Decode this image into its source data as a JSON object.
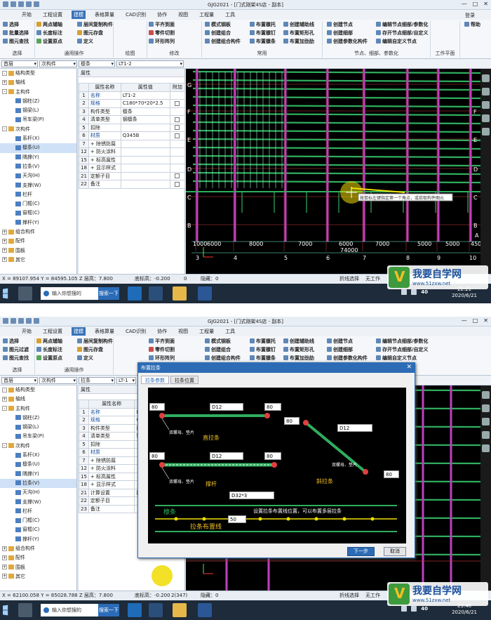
{
  "shot1": {
    "app_title": "GJG2021 - [门式刚架4S店 - 副本]",
    "win_controls": [
      "—",
      "□",
      "✕"
    ],
    "menu": [
      "开始",
      "工程设置",
      "建模",
      "表格算量",
      "CAD识别",
      "协作",
      "视图",
      "工程量",
      "工具"
    ],
    "menu_active": "建模",
    "login": "登录",
    "ribbon": {
      "col1": [
        "选择",
        "批量选择",
        "图元查找"
      ],
      "col2": [
        "两点辅轴",
        "长度标注",
        "设置原点"
      ],
      "col3": [
        "层间复制构件",
        "图元存盘",
        "定义"
      ],
      "col4": [
        "平齐到面",
        "零件切割",
        "环形阵列"
      ],
      "col5": [
        "模式钢板",
        "创建组合",
        "创建组合构件"
      ],
      "col6": [
        "布置檩托",
        "布置檩钉",
        "布置檩条"
      ],
      "col7": [
        "创建辅助线",
        "布置矩形孔",
        "布置加劲肋"
      ],
      "col8": [
        "创建节点",
        "创建细部",
        "创建参数化构件"
      ],
      "col9": [
        "编辑节点细部/参数化",
        "存开节点细部/自定义",
        "编辑自定义节点"
      ],
      "col10": [
        "帮助"
      ],
      "groups": [
        "选择",
        "通用操作",
        "绘图",
        "修改",
        "常用",
        "节点、细部、参数化",
        "工作平面"
      ]
    },
    "prop_combos": [
      "首层",
      "次构件",
      "檩条",
      "LT1-2"
    ],
    "tree": [
      {
        "label": "结构类型",
        "level": 0,
        "expand": "-"
      },
      {
        "label": "轴线",
        "level": 0,
        "expand": "+"
      },
      {
        "label": "主构件",
        "level": 0,
        "expand": "-"
      },
      {
        "label": "钢柱(Z)",
        "level": 1
      },
      {
        "label": "钢梁(L)",
        "level": 1
      },
      {
        "label": "吊车梁(P)",
        "level": 1
      },
      {
        "label": "次构件",
        "level": 0,
        "expand": "-"
      },
      {
        "label": "系杆(X)",
        "level": 1
      },
      {
        "label": "檩条(U)",
        "level": 1,
        "selected": true
      },
      {
        "label": "隅撑(Y)",
        "level": 1
      },
      {
        "label": "拉条(V)",
        "level": 1
      },
      {
        "label": "天沟(H)",
        "level": 1
      },
      {
        "label": "支撑(W)",
        "level": 1
      },
      {
        "label": "栏杆",
        "level": 1
      },
      {
        "label": "门框(C)",
        "level": 1
      },
      {
        "label": "窗框(C)",
        "level": 1
      },
      {
        "label": "撑杆(Y)",
        "level": 1
      },
      {
        "label": "组合构件",
        "level": 0,
        "expand": "+"
      },
      {
        "label": "配件",
        "level": 0,
        "expand": "+"
      },
      {
        "label": "围板",
        "level": 0,
        "expand": "+"
      },
      {
        "label": "其它",
        "level": 0,
        "expand": "+"
      }
    ],
    "props_title": "属性",
    "props_header": [
      "",
      "属性名称",
      "属性值",
      "附加"
    ],
    "props_rows": [
      {
        "n": "1",
        "name": "名称",
        "value": "LT1-2",
        "cb": false
      },
      {
        "n": "2",
        "name": "规格",
        "value": "C180*70*20*2.5",
        "cb": true
      },
      {
        "n": "3",
        "name": "构件类型",
        "value": "檩条",
        "cb": false
      },
      {
        "n": "4",
        "name": "清单类型",
        "value": "钢檩条",
        "cb": true
      },
      {
        "n": "5",
        "name": "扣除",
        "value": "",
        "cb": true
      },
      {
        "n": "6",
        "name": "材质",
        "value": "Q345B",
        "cb": true
      },
      {
        "n": "7",
        "name": "+ 除锈防腐",
        "value": "",
        "cb": false
      },
      {
        "n": "12",
        "name": "+ 防火涂料",
        "value": "",
        "cb": false
      },
      {
        "n": "15",
        "name": "+ 标高属性",
        "value": "",
        "cb": false
      },
      {
        "n": "18",
        "name": "+ 显示样式",
        "value": "",
        "cb": false
      },
      {
        "n": "21",
        "name": "定额子目",
        "value": "",
        "cb": true
      },
      {
        "n": "22",
        "name": "备注",
        "value": "",
        "cb": true
      }
    ],
    "axis_rows": [
      "G",
      "F",
      "E",
      "D",
      "C",
      "B"
    ],
    "axis_rows_right": [
      "F",
      "E",
      "D",
      "C",
      "B"
    ],
    "dims_top": [
      "1000",
      "6000",
      "8000",
      "7000",
      "6000",
      "7000",
      "5000",
      "5000",
      "4500"
    ],
    "dim_total": "74000",
    "axis_cols": [
      "3",
      "4",
      "5",
      "6",
      "7",
      "8",
      "9",
      "10"
    ],
    "axis_cols_right": "A",
    "tooltip": "按鼠标左键指定第一个角点，或拾取构件图元",
    "status": {
      "coords": "X = 89107.954 Y = 84595.105 Z 层高：7.800",
      "bottom_elev": "底标高：-0.200",
      "val": "0",
      "hide": "隐藏：0",
      "mode": "折线选择",
      "notwork": "无工作"
    },
    "taskbar": {
      "search": "输入你想搜的",
      "search_btn": "搜索一下",
      "time": "22:21",
      "date": "2020/6/21",
      "temp": "40"
    }
  },
  "shot2": {
    "app_title": "GJG2021 - [门式刚架4S店 - 副本]",
    "menu": [
      "开始",
      "工程设置",
      "建模",
      "表格算量",
      "CAD识别",
      "协作",
      "视图",
      "工程量",
      "工具"
    ],
    "menu_active": "建模",
    "ribbon": {
      "col1": [
        "选择",
        "图元过滤",
        "图元查找"
      ],
      "col2": [
        "两点辅轴",
        "长度标注",
        "设置原点"
      ],
      "col3": [
        "层间复制构件",
        "图元存盘",
        "定义"
      ],
      "col4": [
        "平齐到面",
        "零件切割",
        "环形阵列"
      ],
      "col5": [
        "模式钢板",
        "创建组合",
        "创建组合构件"
      ],
      "col6": [
        "布置檩托",
        "布置檩钉",
        "布置檩条"
      ],
      "col7": [
        "创建辅助线",
        "布置矩形孔",
        "布置加劲肋"
      ],
      "col8": [
        "创建节点",
        "创建细部",
        "创建参数化构件"
      ],
      "col9": [
        "编辑节点细部/参数化",
        "存开节点细部/自定义",
        "编辑自定义节点"
      ],
      "groups": [
        "选择",
        "通用操作"
      ]
    },
    "prop_combos": [
      "首层",
      "次构件",
      "拉条",
      "LT-1"
    ],
    "tree_selected": "拉条(V)",
    "props_rows": [
      {
        "n": "1",
        "name": "名称",
        "value": "LT-1"
      },
      {
        "n": "2",
        "name": "规格",
        "value": "C"
      },
      {
        "n": "3",
        "name": "构件类型",
        "value": "拉"
      },
      {
        "n": "4",
        "name": "清单类型",
        "value": "钢"
      },
      {
        "n": "5",
        "name": "扣除",
        "value": ""
      },
      {
        "n": "6",
        "name": "材质",
        "value": ""
      },
      {
        "n": "7",
        "name": "+ 除锈防腐",
        "value": ""
      },
      {
        "n": "12",
        "name": "+ 防火涂料",
        "value": ""
      },
      {
        "n": "15",
        "name": "+ 标高属性",
        "value": ""
      },
      {
        "n": "18",
        "name": "+ 显示样式",
        "value": ""
      },
      {
        "n": "21",
        "name": "计算设置",
        "value": "拆"
      },
      {
        "n": "22",
        "name": "定额子目",
        "value": ""
      },
      {
        "n": "23",
        "name": "备注",
        "value": ""
      }
    ],
    "dialog": {
      "title": "布置拉条",
      "tabs": [
        "拉条参数",
        "拉条位置"
      ],
      "top_left": "80",
      "top_right": "80",
      "top_spec": "D12",
      "mid_left": "80",
      "mid_right": "80",
      "mid_spec": "D12",
      "diag_top": "80",
      "diag_spec": "D12",
      "diag_bottom": "80",
      "label_straight": "直拉条",
      "label_brace": "撑杆",
      "label_diag": "斜拉条",
      "note_bolt": "双螺母、垫片",
      "sleeve": "D32*3",
      "purlin": "檩条",
      "count": "50",
      "hint": "设置拉条布置线位置，可以布置多层拉条",
      "line_label": "拉条布置线",
      "btn_next": "下一步",
      "btn_cancel": "取消"
    },
    "status": {
      "coords": "X = 62100.058 Y = 85028.788 Z 层高：7.800",
      "bottom_elev": "底标高：-0.200",
      "val": "2(347)",
      "hide": "隐藏：0",
      "mode": "折线选择",
      "notwork": "无工作"
    },
    "taskbar": {
      "search": "输入你想搜的",
      "search_btn": "搜索一下",
      "time": "23:46",
      "date": "2020/6/21",
      "temp": "40"
    }
  },
  "watermark": {
    "title": "我要自学网",
    "url": "www.51zxw.net"
  },
  "colors": {
    "accent": "#3a73b8",
    "canvas": "#000000",
    "grid_green": "#2fae5e",
    "magenta": "#c040c0",
    "red_line": "#b03030",
    "yellow": "#f0e000"
  }
}
